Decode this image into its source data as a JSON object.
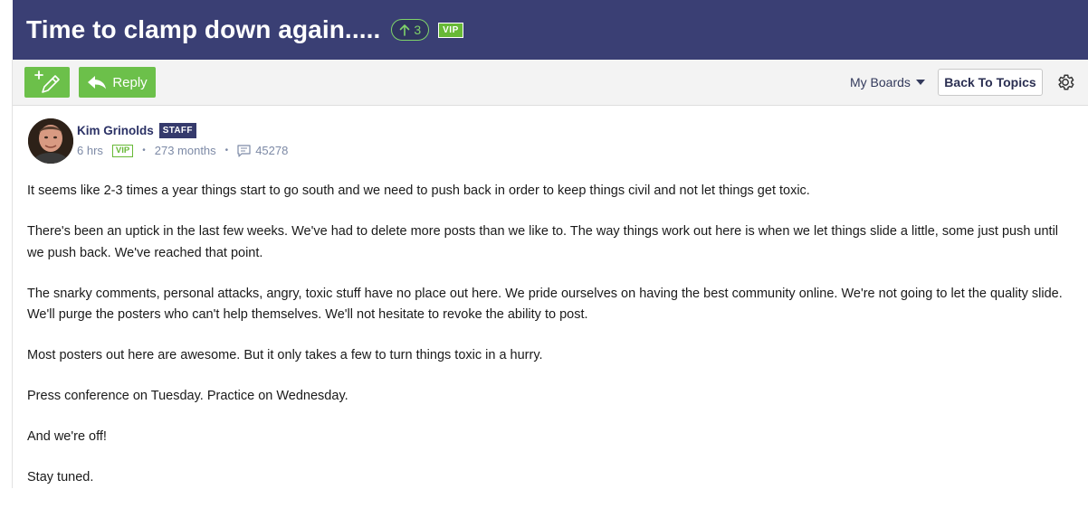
{
  "thread": {
    "title": "Time to clamp down again.....",
    "vote_count": "3",
    "vip_label": "VIP"
  },
  "toolbar": {
    "reply_label": "Reply",
    "my_boards_label": "My Boards",
    "back_label": "Back To Topics"
  },
  "post": {
    "author": "Kim Grinolds",
    "staff_label": "STAFF",
    "time": "6 hrs",
    "vip_label": "VIP",
    "tenure": "273 months",
    "post_count": "45278",
    "paragraphs": [
      "It seems like 2-3 times a year things start to go south and we need to push back in order to keep things civil and not let things get toxic.",
      "There's been an uptick in the last few weeks. We've had to delete more posts than we like to. The way things work out here is when we let things slide a little, some just push until we push back. We've reached that point.",
      "The snarky comments, personal attacks, angry, toxic stuff have no place out here. We pride ourselves on having the best community online. We're not going to let the quality slide. We'll purge the posters who can't help themselves. We'll not hesitate to revoke the ability to post.",
      "Most posters out here are awesome. But it only takes a few to turn things toxic in a hurry.",
      "Press conference on Tuesday. Practice on Wednesday.",
      "And we're off!",
      "Stay tuned."
    ]
  },
  "icons": {
    "new_post": "pencil-plus-icon",
    "reply": "reply-arrow-icon",
    "dropdown": "caret-down-icon",
    "settings": "gear-icon",
    "comments": "comment-icon",
    "vote": "arrow-up-icon"
  },
  "colors": {
    "header_bg": "#3a3f74",
    "accent_green": "#6cc04a",
    "staff_badge": "#353a6c"
  }
}
